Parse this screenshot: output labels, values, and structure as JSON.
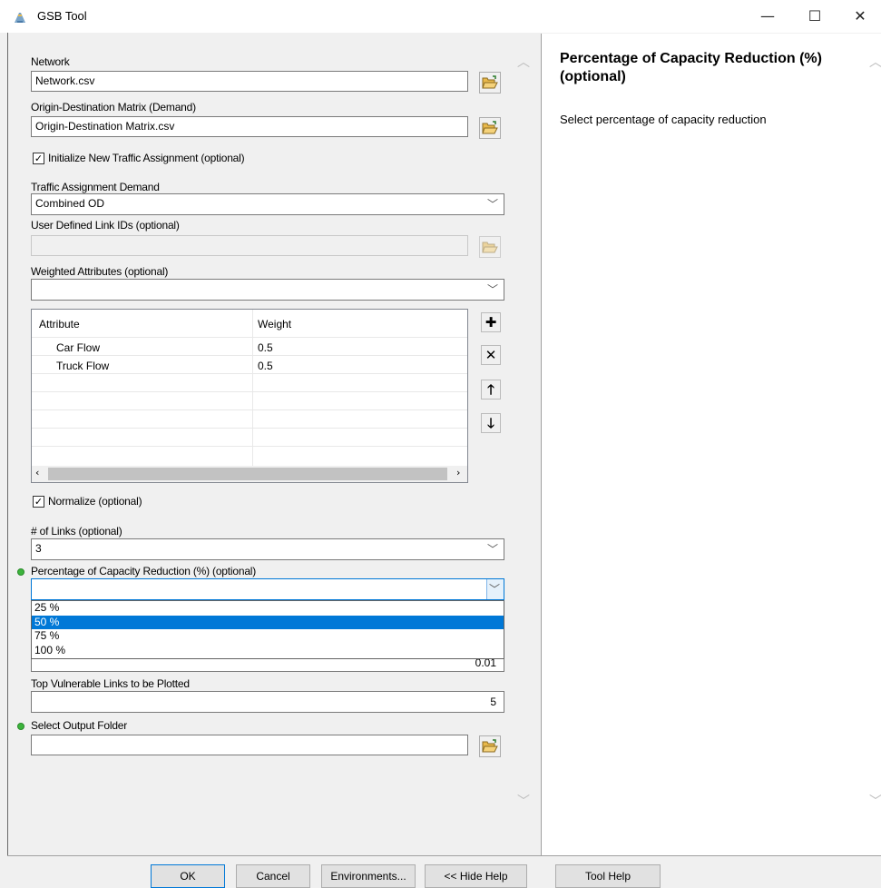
{
  "window": {
    "title": "GSB Tool",
    "minimize": "—",
    "maximize": "☐",
    "close": "✕"
  },
  "form": {
    "network": {
      "label": "Network",
      "value": "Network.csv"
    },
    "od_matrix": {
      "label": "Origin-Destination Matrix (Demand)",
      "value": "Origin-Destination Matrix.csv"
    },
    "init_assignment": {
      "label": "Initialize New Traffic Assignment (optional)",
      "checked": true
    },
    "assignment_demand": {
      "label": "Traffic Assignment Demand",
      "value": "Combined OD"
    },
    "link_ids": {
      "label": "User Defined Link IDs (optional)",
      "value": ""
    },
    "weighted_attributes": {
      "label": "Weighted Attributes (optional)",
      "value": "",
      "columns": [
        "Attribute",
        "Weight"
      ],
      "rows": [
        {
          "attribute": "Car Flow",
          "weight": "0.5"
        },
        {
          "attribute": "Truck Flow",
          "weight": "0.5"
        }
      ]
    },
    "normalize": {
      "label": "Normalize (optional)",
      "checked": true
    },
    "num_links": {
      "label": "# of Links (optional)",
      "value": "3"
    },
    "capacity_reduction": {
      "label": "Percentage of Capacity Reduction (%) (optional)",
      "value": "",
      "options": [
        "25 %",
        "50 %",
        "75 %",
        "100 %"
      ],
      "selected_option": "50 %"
    },
    "hidden_field_value": "0.01",
    "top_links": {
      "label": "Top Vulnerable Links to be Plotted",
      "value": "5"
    },
    "output_folder": {
      "label": "Select Output Folder",
      "value": ""
    }
  },
  "help": {
    "title": "Percentage of Capacity Reduction (%) (optional)",
    "text": "Select percentage of capacity reduction"
  },
  "buttons": {
    "ok": "OK",
    "cancel": "Cancel",
    "environments": "Environments...",
    "hide_help": "<< Hide Help",
    "tool_help": "Tool Help"
  },
  "colors": {
    "selection": "#0078d7",
    "required_dot": "#3cb43c",
    "folder": "#e8b84a"
  },
  "icons": [
    "app-icon",
    "open-folder-icon",
    "plus-icon",
    "delete-icon",
    "arrow-up-icon",
    "arrow-down-icon",
    "chevron-down-icon",
    "scroll-left-icon",
    "scroll-right-icon",
    "checkmark-icon"
  ]
}
